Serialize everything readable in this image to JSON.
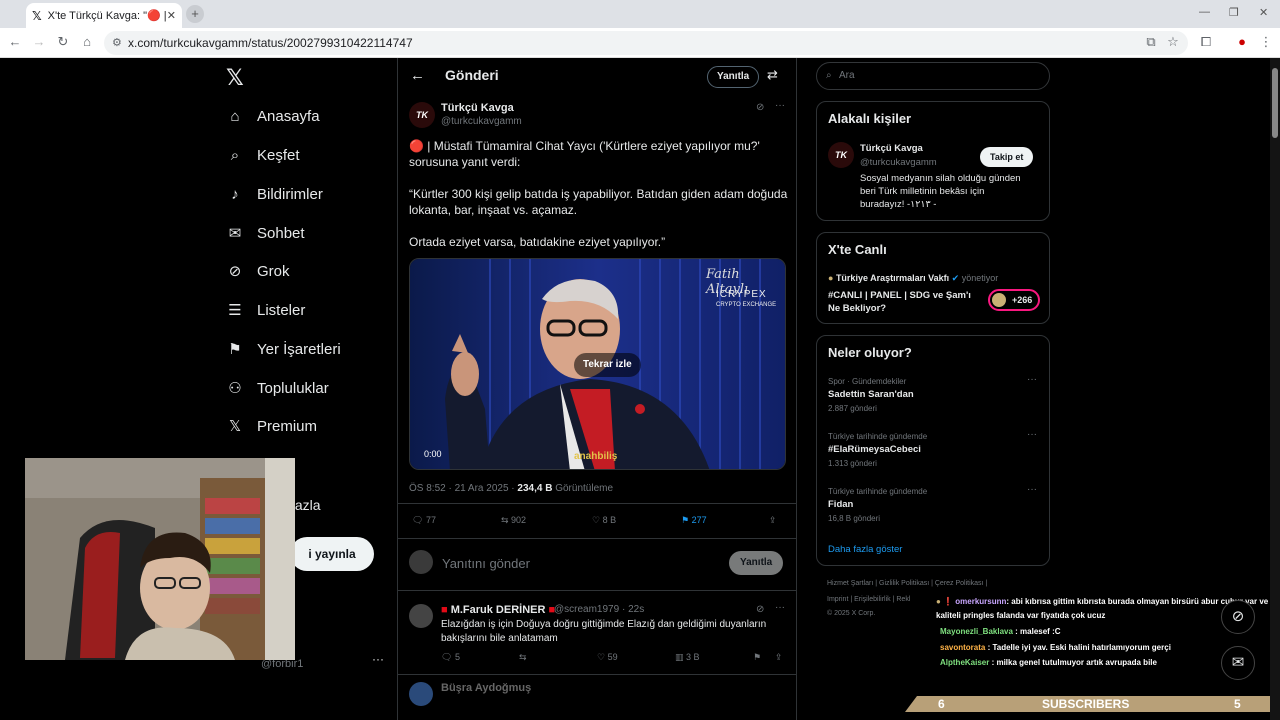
{
  "browser": {
    "tab_title": "X'te Türkçü Kavga: \"🔴 | Müstafi",
    "tab_close": "✕",
    "new_tab": "+",
    "url": "x.com/turkcukavgamm/status/2002799310422114747"
  },
  "nav": {
    "items": [
      {
        "label": "Anasayfa",
        "icon": "home-icon"
      },
      {
        "label": "Keşfet",
        "icon": "search-icon"
      },
      {
        "label": "Bildirimler",
        "icon": "bell-icon"
      },
      {
        "label": "Sohbet",
        "icon": "mail-icon"
      },
      {
        "label": "Grok",
        "icon": "grok-icon"
      },
      {
        "label": "Listeler",
        "icon": "list-icon"
      },
      {
        "label": "Yer İşaretleri",
        "icon": "bookmark-icon"
      },
      {
        "label": "Topluluklar",
        "icon": "community-icon"
      },
      {
        "label": "Premium",
        "icon": "x-icon"
      }
    ],
    "more": "fazla",
    "post_button": "i yayınla",
    "profile_handle": "@forbir1",
    "profile_more": "···"
  },
  "post": {
    "header_title": "Gönderi",
    "reply_label": "Yanıtla",
    "author_name": "Türkçü Kavga",
    "author_handle": "@turkcukavgamm",
    "avatar_text": "TK",
    "text_line1": "🔴 | Müstafi Tümamiral Cihat Yaycı ('Kürtlere eziyet yapılıyor mu?'",
    "text_line2": "sorusuna yanıt verdi:",
    "text_line3": "“Kürtler 300 kişi gelip batıda iş yapabiliyor. Batıdan giden adam doğuda",
    "text_line4": "lokanta, bar, inşaat vs. açamaz.",
    "text_line5": "Ortada eziyet varsa, batıdakine eziyet yapılıyor.”",
    "video": {
      "replay": "Tekrar izle",
      "time": "0:00",
      "watermark_name": "Fatih Altaylı",
      "watermark_brand": "ICRYPEX",
      "watermark_sub": "CRYPTO EXCHANGE",
      "watermark_logo": "anahbiliş"
    },
    "time": "ÖS 8:52 · 21 Ara 2025 · ",
    "views": "234,4 B",
    "views_label": " Görüntüleme",
    "stats": {
      "replies": "77",
      "reposts": "902",
      "likes": "8 B",
      "bookmarks": "277"
    },
    "reply_placeholder": "Yanıtını gönder",
    "reply_button": "Yanıtla"
  },
  "reply": {
    "name": "M.Faruk DERİNER",
    "handle": "@scream1979 · 22s",
    "text_line1": "Elazığdan iş için Doğuya doğru gittiğimde Elazığ dan geldiğimi duyanların",
    "text_line2": "bakışlarını bile anlatamam",
    "stats": {
      "replies": "5",
      "likes": "59",
      "views": "3 B"
    },
    "next_name": "Büşra Aydoğmuş"
  },
  "sidebar": {
    "search_placeholder": "Ara",
    "related_title": "Alakalı kişiler",
    "related_name": "Türkçü Kavga",
    "related_handle": "@turkcukavgamm",
    "related_follow": "Takip et",
    "related_bio_1": "Sosyal medyanın silah olduğu günden",
    "related_bio_2": "beri Türk milletinin bekâsı için",
    "related_bio_3": "buradayız! -١٢١٣ -",
    "live_title": "X'te Canlı",
    "live_host": "Türkiye Araştırmaları Vakfı",
    "live_role": "yönetiyor",
    "live_topic_1": "#CANLI | PANEL | SDG ve Şam'ı",
    "live_topic_2": "Ne Bekliyor?",
    "live_count": "+266",
    "trends_title": "Neler oluyor?",
    "trends": [
      {
        "context": "Spor · Gündemdekiler",
        "name": "Sadettin Saran'dan",
        "count": "2.887 gönderi"
      },
      {
        "context": "Türkiye tarihinde gündemde",
        "name": "#ElaRümeysaCebeci",
        "count": "1.313 gönderi"
      },
      {
        "context": "Türkiye tarihinde gündemde",
        "name": "Fidan",
        "count": "16,8 B gönderi"
      }
    ],
    "show_more": "Daha fazla göster",
    "footer_1": "Hizmet Şartları  |  Gizlilik Politikası  |  Çerez Politikası  |",
    "footer_2": "Imprint  |  Erişilebilirlik  |  Rekl",
    "footer_3": "© 2025 X Corp."
  },
  "overlay": {
    "chat": [
      {
        "user": "omerkursunn",
        "text": ": abi kıbrısa gittim kıbrısta burada olmayan birsürü abur cubur var ve",
        "color": "#c9a6ff"
      },
      {
        "user": "",
        "text": "kaliteli pringles falanda var fiyatıda çok ucuz",
        "color": "#ffffff"
      },
      {
        "user": "Mayonezli_Baklava",
        "text": " : malesef :C",
        "color": "#7fe07f"
      },
      {
        "user": "savontorata",
        "text": " : Tadelle iyi yav. Eski halini hatırlamıyorum gerçi",
        "color": "#ffb347"
      },
      {
        "user": "AlptheKaiser",
        "text": " : milka genel tutulmuyor artık avrupada bile",
        "color": "#7fe07f"
      }
    ],
    "subscribers_left": "6",
    "subscribers_label": "SUBSCRIBERS",
    "subscribers_right": "5"
  },
  "colors": {
    "accent": "#1d9bf0",
    "background": "#000000",
    "text": "#e7e9ea",
    "muted": "#71767b",
    "live_pink": "#f91880"
  }
}
